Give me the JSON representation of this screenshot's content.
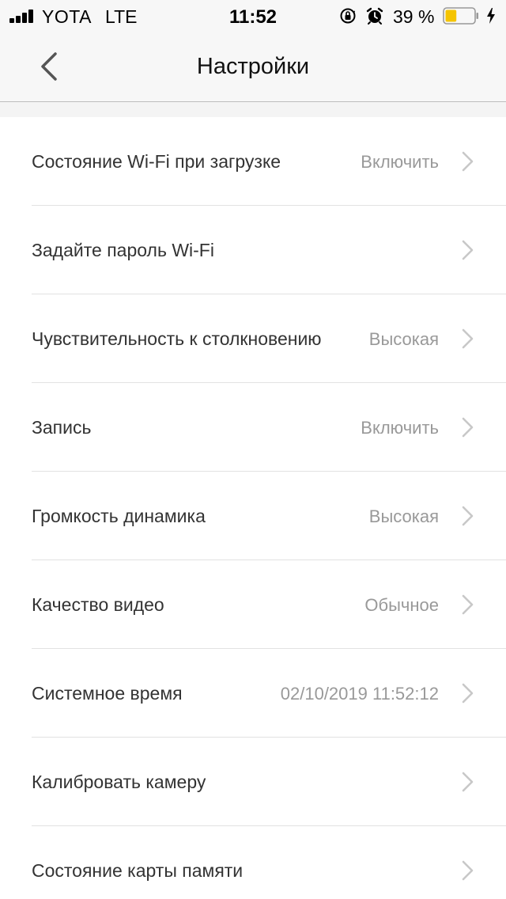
{
  "status_bar": {
    "carrier": "YOTA",
    "network": "LTE",
    "time": "11:52",
    "battery_percent": "39 %",
    "battery_level": 0.39,
    "battery_color": "#f5c400",
    "icons": [
      "signal-icon",
      "orientation-lock-icon",
      "alarm-icon",
      "battery-icon",
      "charging-bolt-icon"
    ]
  },
  "nav": {
    "title": "Настройки",
    "back_icon": "chevron-left-icon"
  },
  "settings": [
    {
      "label": "Состояние Wi-Fi при загрузке",
      "value": "Включить"
    },
    {
      "label": "Задайте пароль Wi-Fi",
      "value": ""
    },
    {
      "label": "Чувствительность к столкновению",
      "value": "Высокая"
    },
    {
      "label": "Запись",
      "value": "Включить"
    },
    {
      "label": "Громкость динамика",
      "value": "Высокая"
    },
    {
      "label": "Качество видео",
      "value": "Обычное"
    },
    {
      "label": "Системное время",
      "value": "02/10/2019 11:52:12"
    },
    {
      "label": "Калибровать камеру",
      "value": ""
    },
    {
      "label": "Состояние карты памяти",
      "value": ""
    }
  ],
  "colors": {
    "accent_chevron": "#c8c8c8",
    "value_text": "#999999"
  }
}
